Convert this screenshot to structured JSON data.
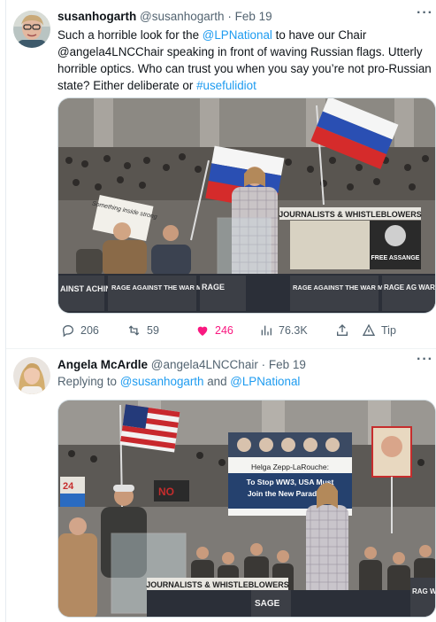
{
  "tweet1": {
    "author_name": "susanhogarth",
    "handle": "@susanhogarth",
    "separator": "·",
    "date": "Feb 19",
    "more": "···",
    "text_parts": [
      {
        "t": "Such a horrible look for the ",
        "link": false
      },
      {
        "t": "@LPNational",
        "link": true
      },
      {
        "t": " to have our Chair @angela4LNCChair speaking in front of waving Russian flags. Utterly horrible optics. Who can trust you when you say you’re not pro-Russian state? Either deliberate or ",
        "link": false
      },
      {
        "t": "#usefulidiot",
        "link": true
      }
    ],
    "image": {
      "signs": {
        "sign_left": "Something inside strong",
        "banner": "JOURNALISTS & WHISTLEBLOWERS",
        "free_assange": "FREE ASSANGE",
        "rage1": "RAGE AGAINST THE WAR MACHINE",
        "rage2": "RAGE AGAINST THE WAR MACHINE",
        "rage3": "RAGE AGAINST THE WAR MACHINE",
        "rage4": "RAGE AGAINST THE WAR MACHINE",
        "rage_left": "AINST ACHINE",
        "rage_mid": "RAGE",
        "rage_right": "RAGE AG WAR MA"
      }
    },
    "actions": {
      "replies": "206",
      "retweets": "59",
      "likes": "246",
      "views": "76.3K",
      "tip": "Tip"
    },
    "colors": {
      "link": "#1d9bf0",
      "like": "#f91880",
      "muted": "#536471"
    }
  },
  "tweet2": {
    "author_name": "Angela McArdle",
    "handle": "@angela4LNCChair",
    "separator": "·",
    "date": "Feb 19",
    "more": "···",
    "reply_prefix": "Replying to ",
    "reply_user1": "@susanhogarth",
    "reply_and": " and ",
    "reply_user2": "@LPNational",
    "image": {
      "signs": {
        "poster_line1": "Helga Zepp-LaRouche:",
        "poster_line2": "To Stop WW3, USA Must",
        "poster_line3": "Join the New Paradigm!",
        "banner": "JOURNALISTS & WHISTLEBLOWERS",
        "sign24": "24",
        "rage_right": "RAG WAR",
        "sage": "SAGE",
        "no": "NO"
      }
    }
  }
}
